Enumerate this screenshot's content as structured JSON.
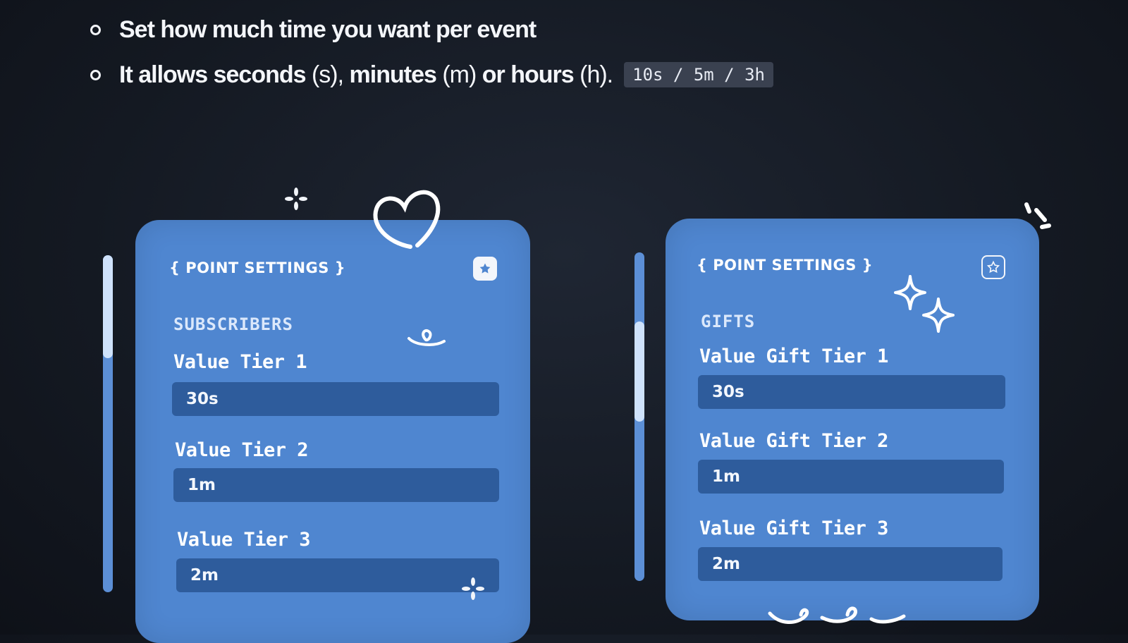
{
  "instructions": {
    "line1": "Set how much time you want per event",
    "line2_a": "It allows seconds",
    "line2_b": "(s),",
    "line2_c": "minutes",
    "line2_d": "(m)",
    "line2_e": "or hours",
    "line2_f": "(h).",
    "code_example": "10s / 5m / 3h"
  },
  "cards": {
    "subscribers": {
      "title": "{ POINT SETTINGS }",
      "section": "SUBSCRIBERS",
      "fields": [
        {
          "label": "Value Tier 1",
          "value": "30s"
        },
        {
          "label": "Value Tier 2",
          "value": "1m"
        },
        {
          "label": "Value Tier 3",
          "value": "2m"
        }
      ]
    },
    "gifts": {
      "title": "{ POINT SETTINGS }",
      "section": "GIFTS",
      "fields": [
        {
          "label": "Value Gift Tier 1",
          "value": "30s"
        },
        {
          "label": "Value Gift Tier 2",
          "value": "1m"
        },
        {
          "label": "Value Gift Tier 3",
          "value": "2m"
        }
      ]
    }
  },
  "icons": {
    "favorite": "star-icon",
    "decorations": [
      "sparkle-icon",
      "heart-icon",
      "swirl-icon",
      "four-point-star-icon",
      "burst-lines-icon"
    ]
  },
  "colors": {
    "card": "#4f86d0",
    "input": "#2e5c9c",
    "background": "#141922"
  }
}
